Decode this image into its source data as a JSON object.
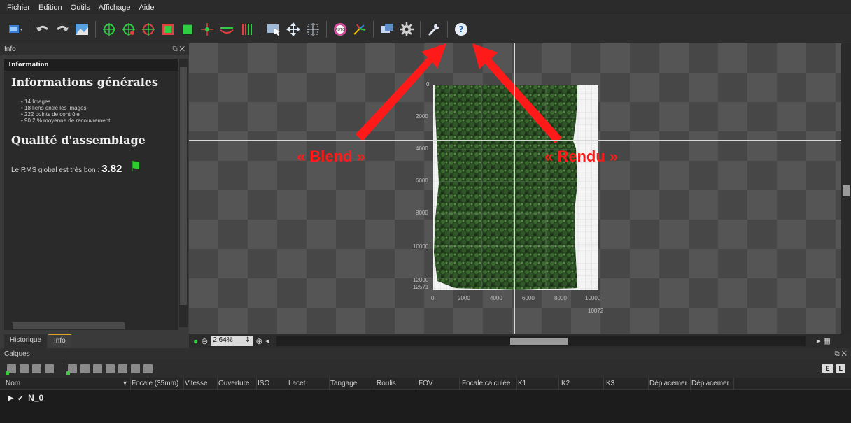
{
  "menu": [
    "Fichier",
    "Edition",
    "Outils",
    "Affichage",
    "Aide"
  ],
  "info_panel": {
    "title": "Info",
    "header": "Information",
    "general_title": "Informations générales",
    "stats": [
      "14 Images",
      "18 liens entre les images",
      "222 points de contrôle",
      "90.2 % moyenne de recouvrement"
    ],
    "quality_title": "Qualité d'assemblage",
    "rms_label": "Le RMS global est très bon :",
    "rms_value": "3.82",
    "tabs": [
      "Historique",
      "Info"
    ]
  },
  "viewer": {
    "y_ticks": [
      "0",
      "2000",
      "4000",
      "6000",
      "8000",
      "10000",
      "12000",
      "12571"
    ],
    "x_ticks": [
      "0",
      "2000",
      "4000",
      "6000",
      "8000",
      "10000"
    ],
    "x_max": "10072",
    "annotations": {
      "blend": "« Blend »",
      "rendu": "« Rendu »"
    }
  },
  "zoom": {
    "value": "2,64%"
  },
  "layers_panel": {
    "title": "Calques",
    "columns": [
      "Nom",
      "Focale (35mm)",
      "Vitesse",
      "Ouverture",
      "ISO",
      "Lacet",
      "Tangage",
      "Roulis",
      "FOV",
      "Focale calculée",
      "K1",
      "K2",
      "K3",
      "Déplacemer",
      "Déplacemer"
    ],
    "rows": [
      {
        "name": "N_0"
      }
    ],
    "view_buttons": [
      "E",
      "L"
    ]
  },
  "colors": {
    "accent_arrow": "#ff1a1a",
    "flag": "#2ecc2e",
    "canvas_bg": "#555555"
  }
}
